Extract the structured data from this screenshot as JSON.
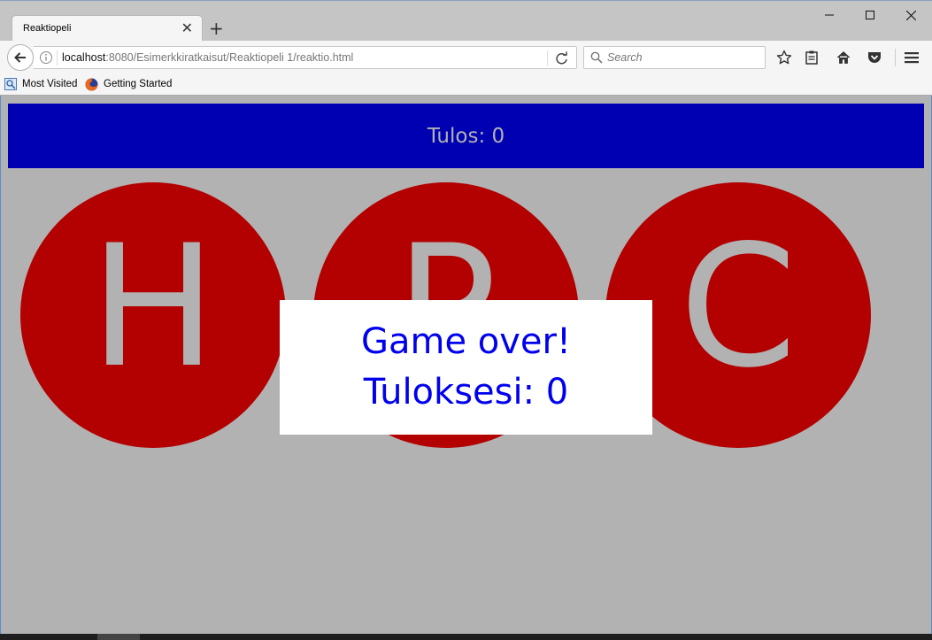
{
  "browser": {
    "tab_title": "Reaktiopeli",
    "tab_close": "✕",
    "new_tab": "+",
    "url_host": "localhost",
    "url_rest": ":8080/Esimerkkiratkaisut/Reaktiopeli 1/reaktio.html",
    "search_placeholder": "Search",
    "bookmarks": [
      "Most Visited",
      "Getting Started"
    ]
  },
  "game": {
    "score_label": "Tulos: 0",
    "buttons": [
      "H",
      "P",
      "C"
    ],
    "game_over_line1": "Game over!",
    "game_over_line2": "Tuloksesi: 0"
  },
  "colors": {
    "score_bar": "#0000b3",
    "circle": "#b30000",
    "page_bg": "#b2b2b2",
    "game_over_text": "#0000ee"
  }
}
